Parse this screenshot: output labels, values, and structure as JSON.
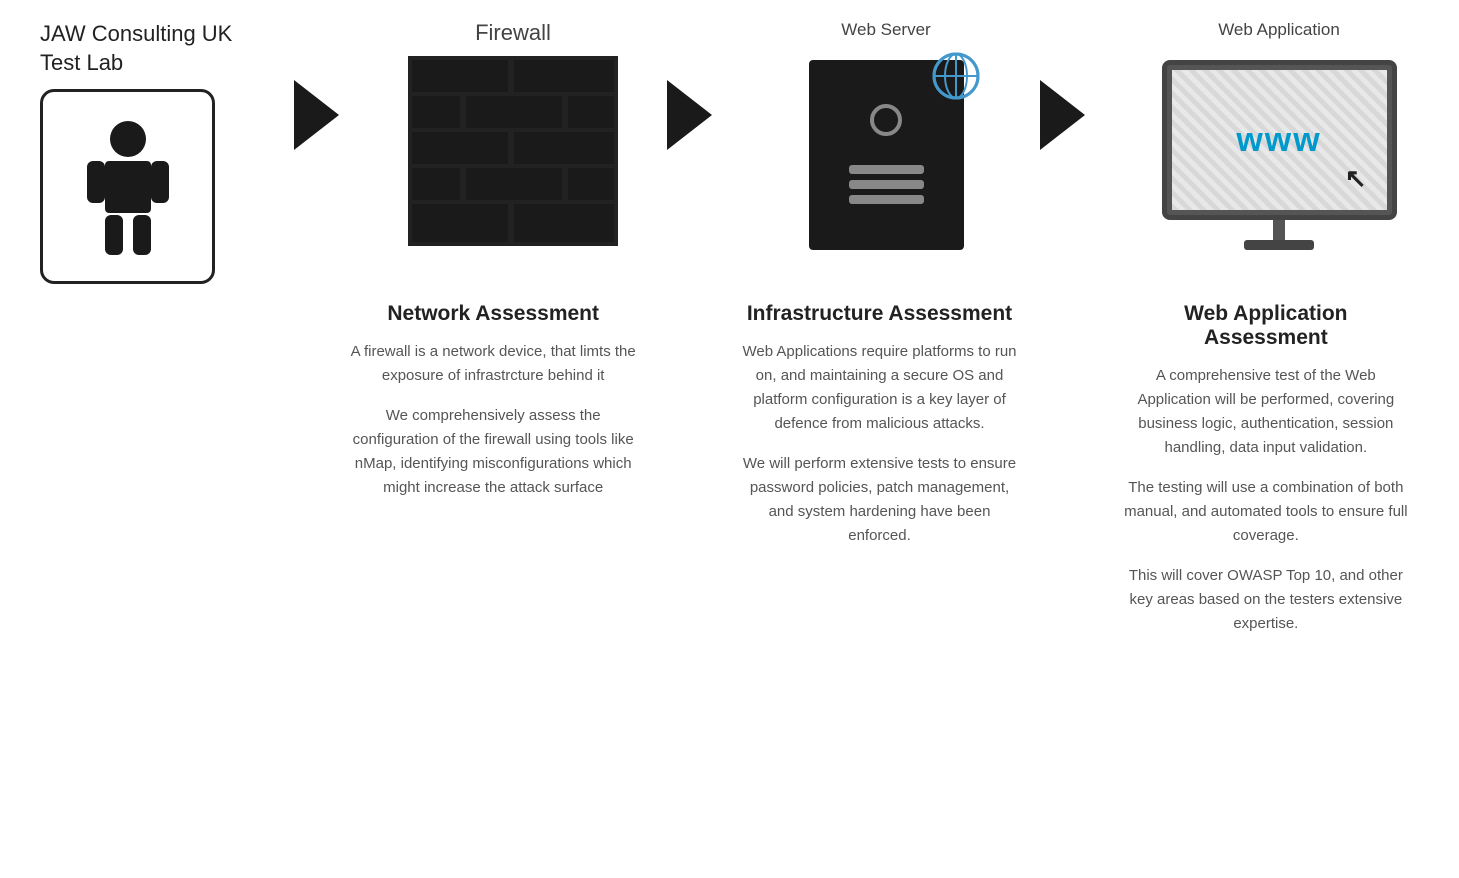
{
  "header": {
    "brand_line1": "JAW Consulting UK",
    "brand_line2": "Test Lab"
  },
  "columns": [
    {
      "id": "firewall",
      "label": "Firewall"
    },
    {
      "id": "webserver",
      "label": "Web Server"
    },
    {
      "id": "webapp",
      "label": "Web Application"
    }
  ],
  "assessments": [
    {
      "id": "network",
      "title": "Network Assessment",
      "paragraphs": [
        "A firewall is a network device, that limts the exposure of infrastrcture behind it",
        "We comprehensively assess the configuration of the firewall using tools like nMap, identifying misconfigurations which might increase the attack surface"
      ]
    },
    {
      "id": "infrastructure",
      "title": "Infrastructure Assessment",
      "paragraphs": [
        "Web Applications require platforms to run on, and maintaining a secure OS and platform configuration is a key layer of defence from malicious attacks.",
        "We will perform extensive tests to ensure password policies, patch management, and system hardening have been enforced."
      ]
    },
    {
      "id": "webapp",
      "title": "Web Application Assessment",
      "paragraphs": [
        "A comprehensive test of the Web Application will be performed, covering business logic, authentication, session handling, data input validation.",
        "The testing will  use a combination of both manual, and automated tools to ensure full coverage.",
        "This will cover OWASP Top 10, and other key areas based on the testers extensive expertise."
      ]
    }
  ],
  "www_label": "www",
  "arrow_char": "❯"
}
